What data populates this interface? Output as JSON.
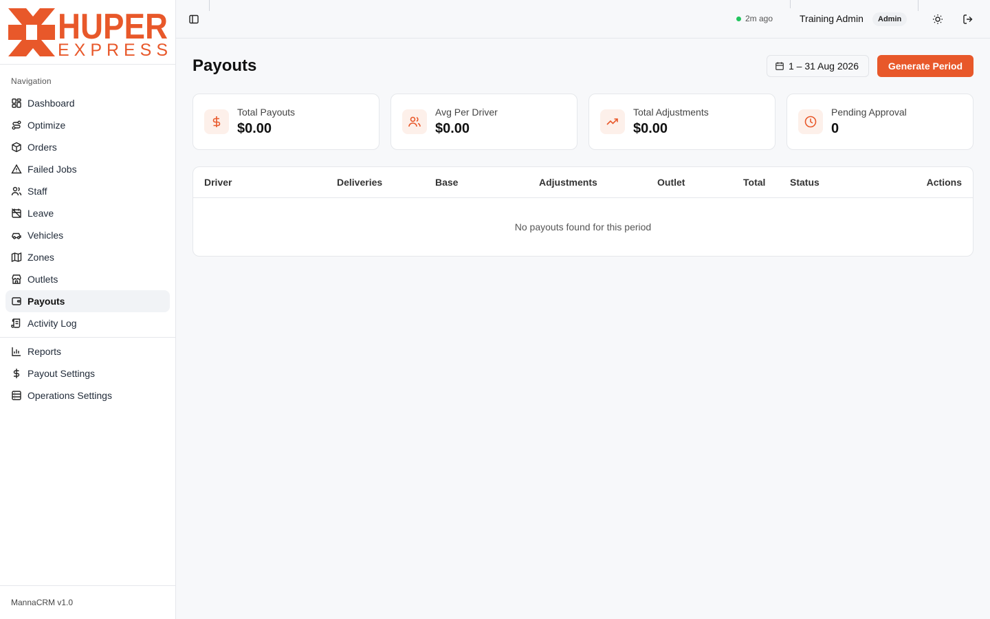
{
  "brand": {
    "primary": "HUPER",
    "secondary": "EXPRESS",
    "accent_color": "#e8582a"
  },
  "sidebar": {
    "nav_title": "Navigation",
    "items": [
      {
        "label": "Dashboard",
        "icon": "dashboard-icon"
      },
      {
        "label": "Optimize",
        "icon": "route-icon"
      },
      {
        "label": "Orders",
        "icon": "package-icon"
      },
      {
        "label": "Failed Jobs",
        "icon": "warning-icon"
      },
      {
        "label": "Staff",
        "icon": "users-icon"
      },
      {
        "label": "Leave",
        "icon": "calendar-off-icon"
      },
      {
        "label": "Vehicles",
        "icon": "car-icon"
      },
      {
        "label": "Zones",
        "icon": "map-icon"
      },
      {
        "label": "Outlets",
        "icon": "store-icon"
      },
      {
        "label": "Payouts",
        "icon": "wallet-icon",
        "active": true
      },
      {
        "label": "Activity Log",
        "icon": "scroll-icon"
      }
    ],
    "secondary_items": [
      {
        "label": "Reports",
        "icon": "bar-chart-icon"
      },
      {
        "label": "Payout Settings",
        "icon": "dollar-icon"
      },
      {
        "label": "Operations Settings",
        "icon": "settings-icon"
      }
    ],
    "version": "MannaCRM v1.0"
  },
  "header": {
    "status_text": "2m ago",
    "user_name": "Training Admin",
    "role": "Admin"
  },
  "page": {
    "title": "Payouts",
    "date_range": "1 – 31 Aug 2026",
    "generate_label": "Generate Period"
  },
  "stats": [
    {
      "label": "Total Payouts",
      "value": "$0.00",
      "icon": "dollar-icon"
    },
    {
      "label": "Avg Per Driver",
      "value": "$0.00",
      "icon": "users-icon"
    },
    {
      "label": "Total Adjustments",
      "value": "$0.00",
      "icon": "trending-up-icon"
    },
    {
      "label": "Pending Approval",
      "value": "0",
      "icon": "clock-icon"
    }
  ],
  "table": {
    "columns": [
      "Driver",
      "Deliveries",
      "Base",
      "Adjustments",
      "Outlet",
      "Total",
      "Status",
      "Actions"
    ],
    "empty_text": "No payouts found for this period"
  }
}
